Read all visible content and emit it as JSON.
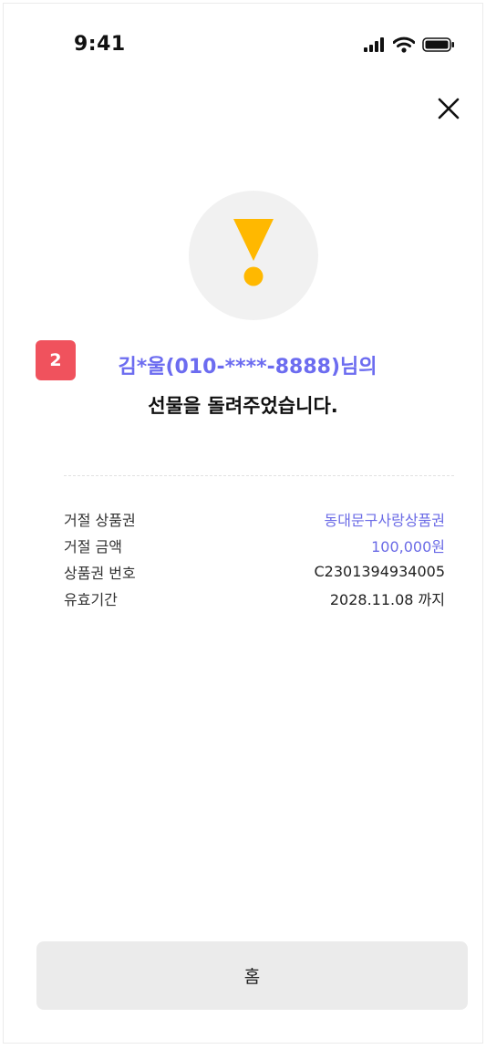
{
  "status_bar": {
    "time": "9:41",
    "icons": [
      "signal-icon",
      "wifi-icon",
      "battery-icon"
    ]
  },
  "header": {
    "close_icon": "close-icon"
  },
  "alert": {
    "icon": "exclamation-icon",
    "icon_color": "#FFB800",
    "circle_color": "#F1F1F1"
  },
  "badge": {
    "label": "2",
    "color": "#F0525D"
  },
  "message": {
    "recipient": "김*울(010-****-8888)님의",
    "recipient_color": "#6C6CF0",
    "body": "선물을 돌려주었습니다."
  },
  "details": [
    {
      "label": "거절 상품권",
      "value": "동대문구사랑상품권",
      "accent": true
    },
    {
      "label": "거절 금액",
      "value": "100,000원",
      "accent": true
    },
    {
      "label": "상품권 번호",
      "value": "C2301394934005",
      "accent": false
    },
    {
      "label": "유효기간",
      "value": "2028.11.08 까지",
      "accent": false
    }
  ],
  "footer": {
    "home_label": "홈"
  }
}
